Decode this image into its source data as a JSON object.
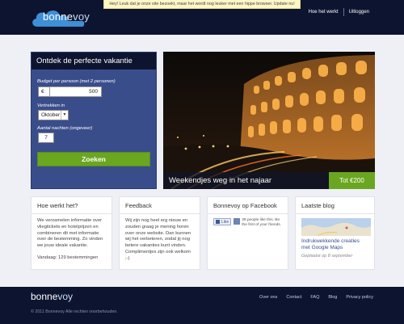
{
  "notice": "Hey! Leuk dat je onze site bezoekt, maar het wordt nog leuker met een hippe browser. Update nu!",
  "logo": {
    "part1": "bonne",
    "part2": "voy"
  },
  "topnav": {
    "how": "Hoe het werkt",
    "logout": "Uitloggen"
  },
  "search": {
    "title": "Ontdek de perfecte vakantie",
    "budget_label": "Budget per persoon (met 2 personen)",
    "currency": "€",
    "budget_value": "500",
    "depart_label": "Vertrekken in",
    "month_value": "Oktober",
    "nights_label": "Aantal nachten (ongeveer)",
    "nights_value": "7",
    "button": "Zoeken"
  },
  "hero": {
    "caption": "Weekendjes weg in het najaar",
    "price": "Tot €200"
  },
  "boxes": {
    "how": {
      "title": "Hoe werkt het?",
      "text": "We verzamelen informatie over vliegtickets en hotelprijzen en combineren dit met informatie over de bestemming. Zo vinden we jouw ideale vakantie.",
      "count": "Vandaag: 129 bestemmingen"
    },
    "feedback": {
      "title": "Feedback",
      "text": "Wij zijn nog heel erg nieuw en zouden graag je mening horen over onze website. Dan kunnen wij het verbeteren, zodat jij nog betere vakanties kunt vinden. Complimentjes zijn ook welkom ;-)"
    },
    "facebook": {
      "title": "Bonnevoy op Facebook",
      "like": "Like",
      "text": "39 people like this. Be the first of your friends."
    },
    "blog": {
      "title": "Laatste blog",
      "link": "Indrukwekkende creaties met Google Maps",
      "date": "Geplaatst op 8 september"
    }
  },
  "footer": {
    "logo1": "bonne",
    "logo2": "voy",
    "copyright": "© 2011 Bonnevoy Alle rechten voorbehouden.",
    "links": [
      "Over ons",
      "Contact",
      "FAQ",
      "Blog",
      "Privacy policy"
    ]
  }
}
